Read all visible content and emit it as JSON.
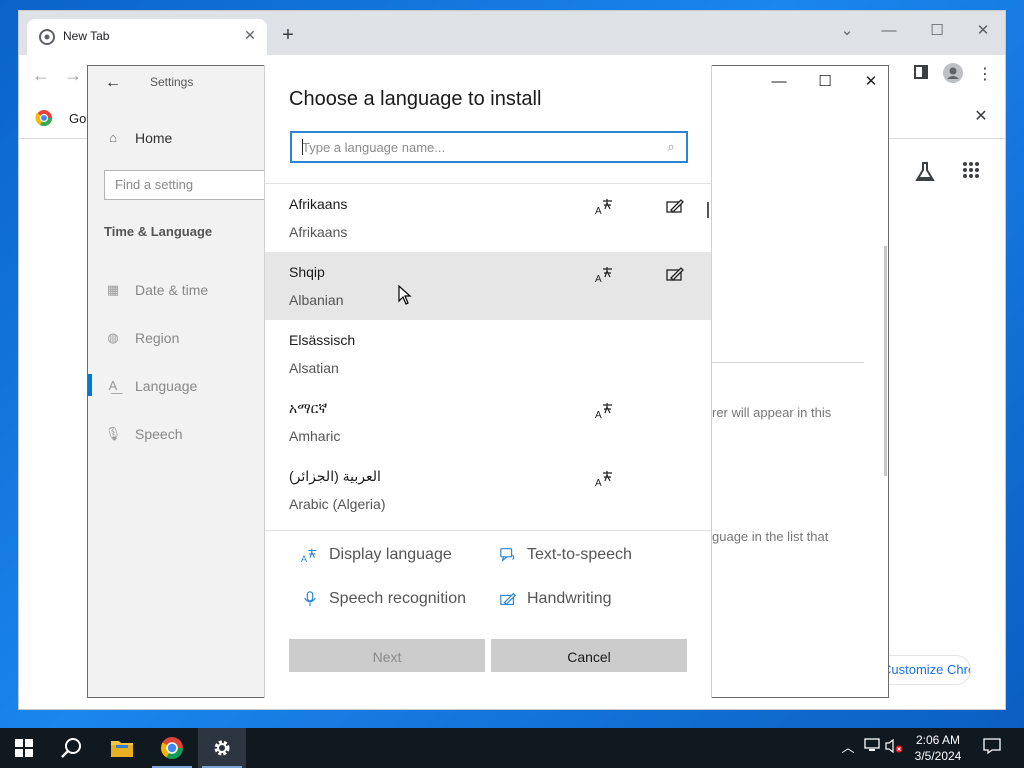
{
  "browser": {
    "tab_title": "New Tab",
    "bookmark_label": "Go",
    "customize_label": "Customize Chrome"
  },
  "settings": {
    "window_title": "Settings",
    "home_label": "Home",
    "find_placeholder": "Find a setting",
    "section_title": "Time & Language",
    "nav_items": [
      {
        "label": "Date & time",
        "icon": "calendar-clock-icon"
      },
      {
        "label": "Region",
        "icon": "globe-icon"
      },
      {
        "label": "Language",
        "icon": "language-icon"
      },
      {
        "label": "Speech",
        "icon": "microphone-icon"
      }
    ],
    "right_text_1": "rer will appear in this",
    "right_text_2": "guage in the list that"
  },
  "dialog": {
    "title": "Choose a language to install",
    "search_placeholder": "Type a language name...",
    "languages": [
      {
        "native": "Afrikaans",
        "english": "Afrikaans",
        "display": true,
        "handwriting": true
      },
      {
        "native": "Shqip",
        "english": "Albanian",
        "display": true,
        "handwriting": true
      },
      {
        "native": "Elsässisch",
        "english": "Alsatian",
        "display": false,
        "handwriting": false
      },
      {
        "native": "አማርኛ",
        "english": "Amharic",
        "display": true,
        "handwriting": false
      },
      {
        "native": "العربية (الجزائر)",
        "english": "Arabic (Algeria)",
        "display": true,
        "handwriting": false
      }
    ],
    "legend": {
      "display_language": "Display language",
      "text_to_speech": "Text-to-speech",
      "speech_recognition": "Speech recognition",
      "handwriting": "Handwriting"
    },
    "next_label": "Next",
    "cancel_label": "Cancel"
  },
  "taskbar": {
    "time": "2:06 AM",
    "date": "3/5/2024"
  },
  "colors": {
    "accent": "#0078d7",
    "search_border": "#2a86d2",
    "taskbar": "#101820"
  }
}
